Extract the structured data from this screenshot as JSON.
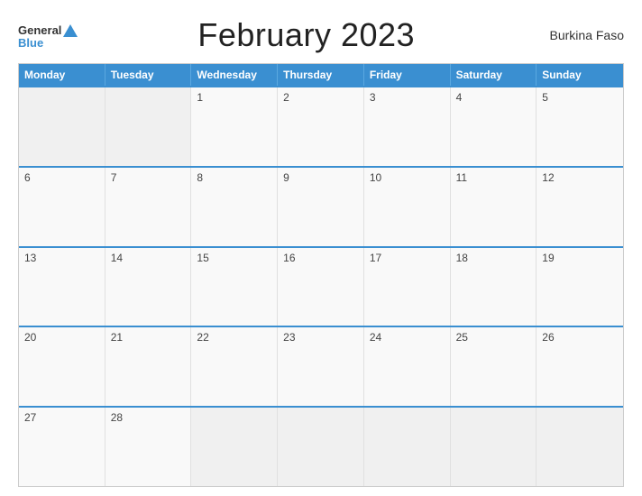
{
  "header": {
    "logo": {
      "general": "General",
      "blue": "Blue",
      "triangle_color": "#3a8fd1"
    },
    "title": "February 2023",
    "country": "Burkina Faso"
  },
  "calendar": {
    "days_of_week": [
      "Monday",
      "Tuesday",
      "Wednesday",
      "Thursday",
      "Friday",
      "Saturday",
      "Sunday"
    ],
    "weeks": [
      [
        {
          "day": "",
          "empty": true
        },
        {
          "day": "",
          "empty": true
        },
        {
          "day": "1",
          "empty": false
        },
        {
          "day": "2",
          "empty": false
        },
        {
          "day": "3",
          "empty": false
        },
        {
          "day": "4",
          "empty": false
        },
        {
          "day": "5",
          "empty": false
        }
      ],
      [
        {
          "day": "6",
          "empty": false
        },
        {
          "day": "7",
          "empty": false
        },
        {
          "day": "8",
          "empty": false
        },
        {
          "day": "9",
          "empty": false
        },
        {
          "day": "10",
          "empty": false
        },
        {
          "day": "11",
          "empty": false
        },
        {
          "day": "12",
          "empty": false
        }
      ],
      [
        {
          "day": "13",
          "empty": false
        },
        {
          "day": "14",
          "empty": false
        },
        {
          "day": "15",
          "empty": false
        },
        {
          "day": "16",
          "empty": false
        },
        {
          "day": "17",
          "empty": false
        },
        {
          "day": "18",
          "empty": false
        },
        {
          "day": "19",
          "empty": false
        }
      ],
      [
        {
          "day": "20",
          "empty": false
        },
        {
          "day": "21",
          "empty": false
        },
        {
          "day": "22",
          "empty": false
        },
        {
          "day": "23",
          "empty": false
        },
        {
          "day": "24",
          "empty": false
        },
        {
          "day": "25",
          "empty": false
        },
        {
          "day": "26",
          "empty": false
        }
      ],
      [
        {
          "day": "27",
          "empty": false
        },
        {
          "day": "28",
          "empty": false
        },
        {
          "day": "",
          "empty": true
        },
        {
          "day": "",
          "empty": true
        },
        {
          "day": "",
          "empty": true
        },
        {
          "day": "",
          "empty": true
        },
        {
          "day": "",
          "empty": true
        }
      ]
    ]
  }
}
